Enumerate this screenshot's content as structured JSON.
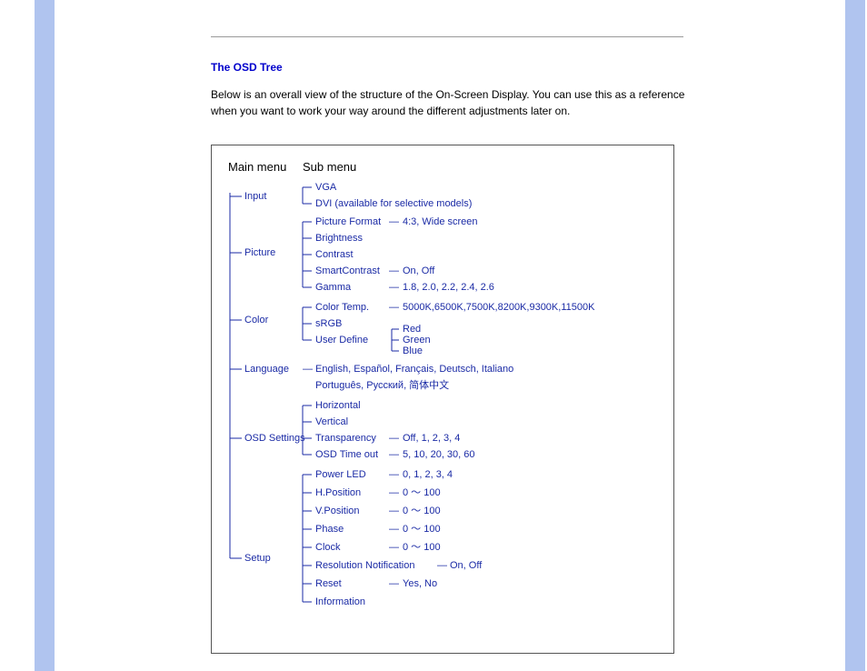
{
  "heading": "The OSD Tree",
  "intro": "Below is an overall view of the structure of the On-Screen Display. You can use this as a reference when you want to work your way around the different adjustments later on.",
  "headers": {
    "main": "Main menu",
    "sub": "Sub menu"
  },
  "sep": "—",
  "tilde": "～",
  "menu": {
    "input": {
      "label": "Input",
      "items": {
        "vga": "VGA",
        "dvi": "DVI (available for selective models)"
      }
    },
    "picture": {
      "label": "Picture",
      "items": {
        "format": {
          "label": "Picture Format",
          "values": "4:3, Wide screen"
        },
        "brightness": "Brightness",
        "contrast": "Contrast",
        "smartcontrast": {
          "label": "SmartContrast",
          "values": "On, Off"
        },
        "gamma": {
          "label": "Gamma",
          "values": "1.8, 2.0, 2.2, 2.4, 2.6"
        }
      }
    },
    "color": {
      "label": "Color",
      "items": {
        "temp": {
          "label": "Color Temp.",
          "values": "5000K,6500K,7500K,8200K,9300K,11500K"
        },
        "srgb": "sRGB",
        "user": {
          "label": "User Define",
          "values": {
            "r": "Red",
            "g": "Green",
            "b": "Blue"
          }
        }
      }
    },
    "language": {
      "label": "Language",
      "line1": "English, Español, Français, Deutsch, Italiano",
      "line2": "Português, Русский, 简体中文"
    },
    "osd": {
      "label": "OSD Settings",
      "items": {
        "horizontal": "Horizontal",
        "vertical": "Vertical",
        "transparency": {
          "label": "Transparency",
          "values": "Off, 1, 2, 3, 4"
        },
        "timeout": {
          "label": "OSD Time out",
          "values": "5, 10, 20, 30, 60"
        }
      }
    },
    "setup": {
      "label": "Setup",
      "items": {
        "powerled": {
          "label": "Power LED",
          "values": "0, 1, 2, 3, 4"
        },
        "hpos": {
          "label": "H.Position",
          "range": "0 ～ 100"
        },
        "vpos": {
          "label": "V.Position",
          "range": "0 ～ 100"
        },
        "phase": {
          "label": "Phase",
          "range": "0 ～ 100"
        },
        "clock": {
          "label": "Clock",
          "range": "0 ～ 100"
        },
        "resnotif": {
          "label": "Resolution Notification",
          "values": "On, Off"
        },
        "reset": {
          "label": "Reset",
          "values": "Yes, No"
        },
        "info": "Information"
      }
    }
  }
}
